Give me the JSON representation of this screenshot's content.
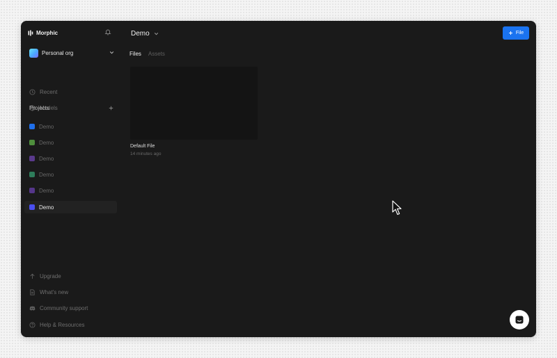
{
  "sidebar": {
    "brand": {
      "name": "Morphic",
      "icon": "morphic-logo-icon"
    },
    "bell_icon": "bell-icon",
    "org": {
      "name": "Personal org"
    },
    "nav": [
      {
        "label": "Recent",
        "icon": "clock-icon"
      },
      {
        "label": "Models",
        "icon": "cube-icon"
      }
    ],
    "projects_title": "Projects",
    "projects": [
      {
        "label": "Demo",
        "color": "#1f6feb"
      },
      {
        "label": "Demo",
        "color": "#4f8f3d"
      },
      {
        "label": "Demo",
        "color": "#5a3a8c"
      },
      {
        "label": "Demo",
        "color": "#2e7d5b"
      },
      {
        "label": "Demo",
        "color": "#55368a"
      },
      {
        "label": "Demo",
        "color": "#4a4ff0",
        "active": true
      }
    ],
    "footer": [
      {
        "label": "Upgrade",
        "icon": "arrow-up-icon"
      },
      {
        "label": "What's new",
        "icon": "document-icon"
      },
      {
        "label": "Community support",
        "icon": "discord-icon"
      },
      {
        "label": "Help & Resources",
        "icon": "help-circle-icon"
      }
    ]
  },
  "main": {
    "breadcrumb": "Demo",
    "new_file_button": "File",
    "tabs": [
      {
        "label": "Files",
        "active": true
      },
      {
        "label": "Assets",
        "active": false
      }
    ],
    "files": [
      {
        "name": "Default File",
        "modified": "14 minutes ago"
      }
    ]
  },
  "colors": {
    "accent": "#1a73f0",
    "background": "#1a1a1a"
  }
}
